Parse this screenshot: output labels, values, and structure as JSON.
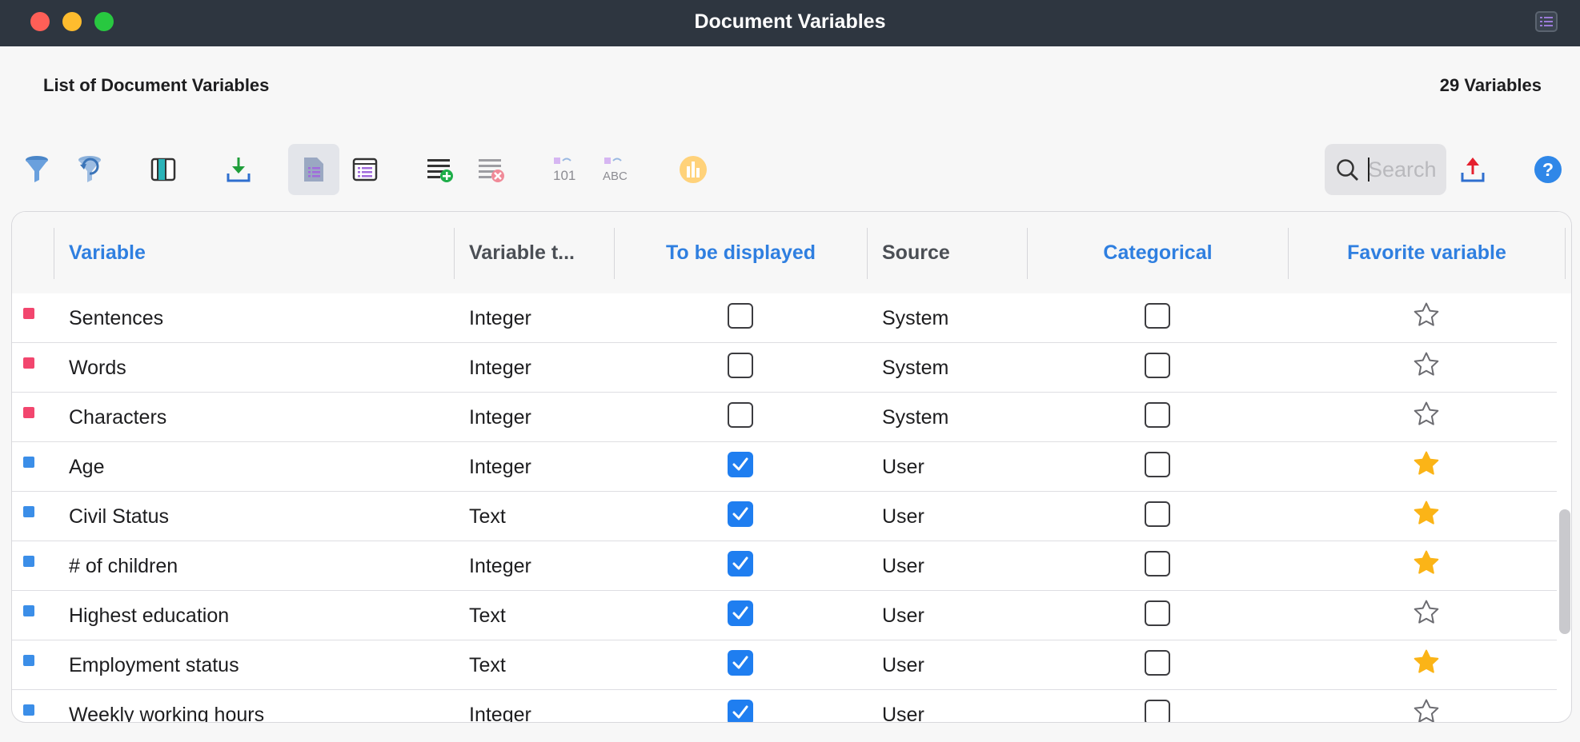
{
  "window": {
    "title": "Document Variables"
  },
  "header": {
    "list_title": "List of Document Variables",
    "count": "29 Variables"
  },
  "toolbar": {
    "search_placeholder": "Search",
    "buttons": [
      {
        "name": "filter-icon"
      },
      {
        "name": "reset-filter-icon"
      },
      {
        "name": "columns-icon"
      },
      {
        "name": "import-icon"
      },
      {
        "name": "document-list-icon",
        "active": true
      },
      {
        "name": "code-list-icon"
      },
      {
        "name": "add-variable-icon"
      },
      {
        "name": "delete-variable-icon"
      },
      {
        "name": "convert-to-number-icon",
        "label": "101"
      },
      {
        "name": "convert-to-text-icon",
        "label": "ABC"
      },
      {
        "name": "statistics-icon"
      },
      {
        "name": "export-icon"
      },
      {
        "name": "help-icon"
      }
    ]
  },
  "table": {
    "columns": [
      {
        "label": "Variable",
        "style": "blue"
      },
      {
        "label": "Variable t...",
        "style": "grey"
      },
      {
        "label": "To be displayed",
        "style": "blue"
      },
      {
        "label": "Source",
        "style": "grey"
      },
      {
        "label": "Categorical",
        "style": "blue"
      },
      {
        "label": "Favorite variable",
        "style": "blue"
      }
    ],
    "rows": [
      {
        "variable": "Sentences",
        "type": "Integer",
        "displayed": false,
        "source": "System",
        "categorical": false,
        "favorite": false,
        "marker": "system"
      },
      {
        "variable": "Words",
        "type": "Integer",
        "displayed": false,
        "source": "System",
        "categorical": false,
        "favorite": false,
        "marker": "system"
      },
      {
        "variable": "Characters",
        "type": "Integer",
        "displayed": false,
        "source": "System",
        "categorical": false,
        "favorite": false,
        "marker": "system"
      },
      {
        "variable": "Age",
        "type": "Integer",
        "displayed": true,
        "source": "User",
        "categorical": false,
        "favorite": true,
        "marker": "user"
      },
      {
        "variable": "Civil Status",
        "type": "Text",
        "displayed": true,
        "source": "User",
        "categorical": false,
        "favorite": true,
        "marker": "user"
      },
      {
        "variable": "# of children",
        "type": "Integer",
        "displayed": true,
        "source": "User",
        "categorical": false,
        "favorite": true,
        "marker": "user"
      },
      {
        "variable": "Highest education",
        "type": "Text",
        "displayed": true,
        "source": "User",
        "categorical": false,
        "favorite": false,
        "marker": "user"
      },
      {
        "variable": "Employment status",
        "type": "Text",
        "displayed": true,
        "source": "User",
        "categorical": false,
        "favorite": true,
        "marker": "user"
      },
      {
        "variable": "Weekly working hours",
        "type": "Integer",
        "displayed": true,
        "source": "User",
        "categorical": false,
        "favorite": false,
        "marker": "user"
      }
    ]
  },
  "colors": {
    "system_marker": "#f2466e",
    "user_marker": "#3b8ee8",
    "accent": "#1f7ef0",
    "star_filled": "#fbb417"
  }
}
